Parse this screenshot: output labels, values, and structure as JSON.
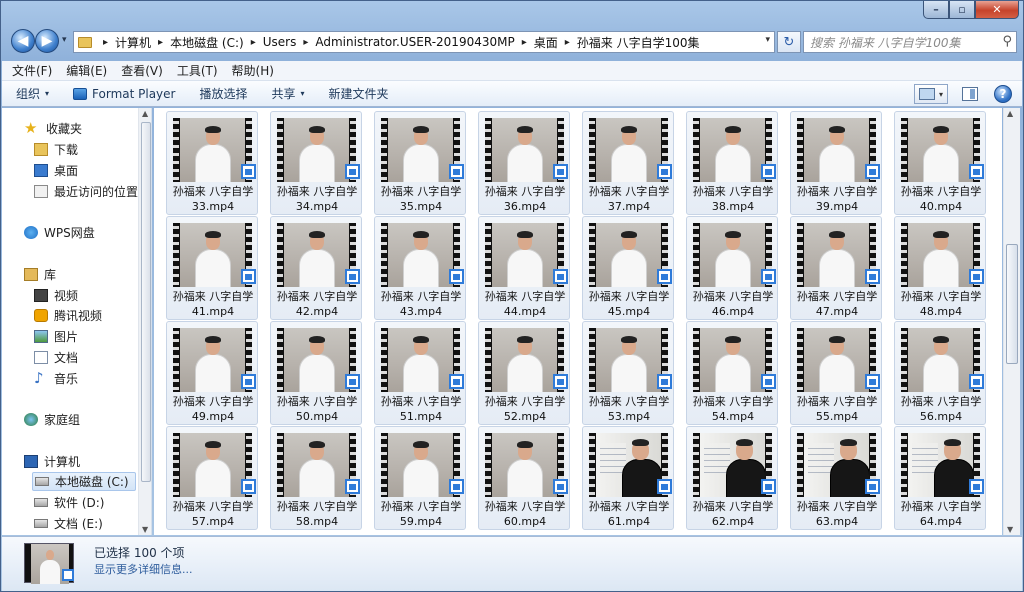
{
  "window": {
    "controls": {
      "minimize": "–",
      "maximize": "▫",
      "close": "✕"
    }
  },
  "nav": {
    "back_glyph": "◀",
    "forward_glyph": "▶",
    "history_glyph": "▾"
  },
  "address": {
    "crumbs": [
      "计算机",
      "本地磁盘 (C:)",
      "Users",
      "Administrator.USER-20190430MP",
      "桌面",
      "孙福来 八字自学100集"
    ],
    "separator": "▸",
    "refresh_glyph": "↻"
  },
  "search": {
    "placeholder": "搜索 孙福来 八字自学100集",
    "icon_glyph": "⚲"
  },
  "menubar": [
    "文件(F)",
    "编辑(E)",
    "查看(V)",
    "工具(T)",
    "帮助(H)"
  ],
  "toolbar": {
    "organize": "组织",
    "format_player": "Format Player",
    "play_selection": "播放选择",
    "share": "共享",
    "new_folder": "新建文件夹",
    "help_glyph": "?",
    "dropdown_glyph": "▾"
  },
  "navpane": {
    "favorites": "收藏夹",
    "downloads": "下载",
    "desktop": "桌面",
    "recent": "最近访问的位置",
    "wps": "WPS网盘",
    "libraries": "库",
    "videos": "视频",
    "tencent_video": "腾讯视频",
    "pictures": "图片",
    "documents": "文档",
    "music": "音乐",
    "homegroup": "家庭组",
    "computer": "计算机",
    "drive_c": "本地磁盘 (C:)",
    "drive_d": "软件 (D:)",
    "drive_e": "文档 (E:)",
    "star_glyph": "★",
    "music_glyph": "♪"
  },
  "files": {
    "name_prefix": "孙福来 八字自学",
    "items": [
      {
        "num": "33.mp4",
        "style": "a"
      },
      {
        "num": "34.mp4",
        "style": "a"
      },
      {
        "num": "35.mp4",
        "style": "a"
      },
      {
        "num": "36.mp4",
        "style": "a"
      },
      {
        "num": "37.mp4",
        "style": "a"
      },
      {
        "num": "38.mp4",
        "style": "a"
      },
      {
        "num": "39.mp4",
        "style": "a"
      },
      {
        "num": "40.mp4",
        "style": "a"
      },
      {
        "num": "41.mp4",
        "style": "a"
      },
      {
        "num": "42.mp4",
        "style": "a"
      },
      {
        "num": "43.mp4",
        "style": "a"
      },
      {
        "num": "44.mp4",
        "style": "a"
      },
      {
        "num": "45.mp4",
        "style": "a"
      },
      {
        "num": "46.mp4",
        "style": "a"
      },
      {
        "num": "47.mp4",
        "style": "a"
      },
      {
        "num": "48.mp4",
        "style": "a"
      },
      {
        "num": "49.mp4",
        "style": "a"
      },
      {
        "num": "50.mp4",
        "style": "a"
      },
      {
        "num": "51.mp4",
        "style": "a"
      },
      {
        "num": "52.mp4",
        "style": "a"
      },
      {
        "num": "53.mp4",
        "style": "a"
      },
      {
        "num": "54.mp4",
        "style": "a"
      },
      {
        "num": "55.mp4",
        "style": "a"
      },
      {
        "num": "56.mp4",
        "style": "a"
      },
      {
        "num": "57.mp4",
        "style": "a"
      },
      {
        "num": "58.mp4",
        "style": "a"
      },
      {
        "num": "59.mp4",
        "style": "a"
      },
      {
        "num": "60.mp4",
        "style": "a"
      },
      {
        "num": "61.mp4",
        "style": "b"
      },
      {
        "num": "62.mp4",
        "style": "b"
      },
      {
        "num": "63.mp4",
        "style": "b"
      },
      {
        "num": "64.mp4",
        "style": "b"
      }
    ]
  },
  "details": {
    "selected": "已选择 100 个项",
    "more": "显示更多详细信息..."
  },
  "colors": {
    "accent": "#2f7bd9",
    "title_bg": "#8fb1da",
    "close": "#c6432b"
  }
}
